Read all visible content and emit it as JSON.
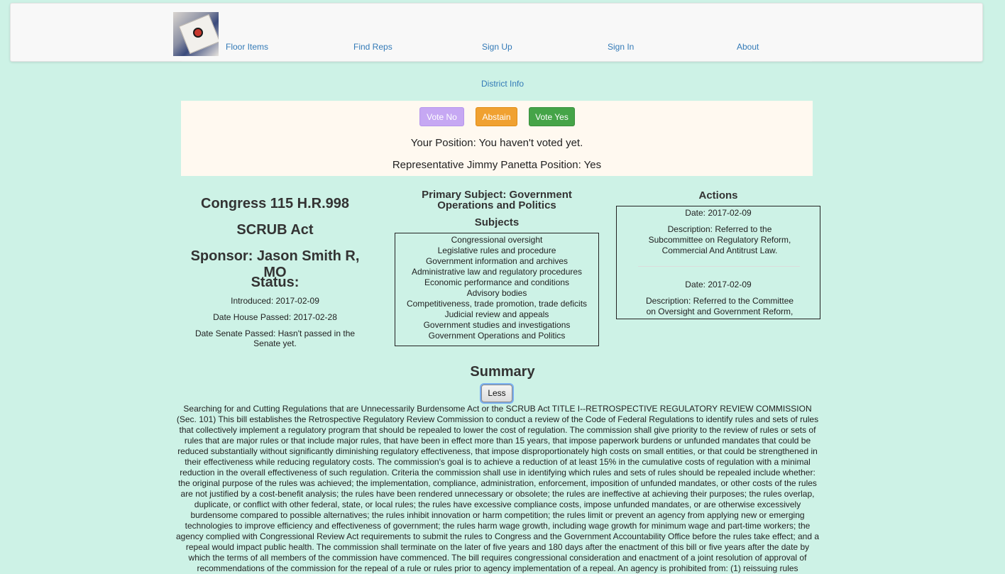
{
  "nav": {
    "items": [
      "Floor Items",
      "Find Reps",
      "Sign Up",
      "Sign In",
      "About"
    ],
    "district_link": "District Info"
  },
  "vote": {
    "buttons": {
      "no": "Vote No",
      "abstain": "Abstain",
      "yes": "Vote Yes"
    },
    "your_position": "Your Position: You haven't voted yet.",
    "rep_position": "Representative Jimmy Panetta Position: Yes",
    "colors": {
      "no": "#c6a8f3",
      "abstain": "#f0a131",
      "yes": "#45a448"
    }
  },
  "bill": {
    "congress": "Congress 115 H.R.998",
    "name": "SCRUB Act",
    "sponsor": "Sponsor: Jason Smith R, MO",
    "status_heading": "Status:",
    "introduced": "Introduced: 2017-02-09",
    "house_passed": "Date House Passed: 2017-02-28",
    "senate_passed": "Date Senate Passed: Hasn't passed in the Senate yet."
  },
  "subjects": {
    "primary": "Primary Subject: Government Operations and Politics",
    "heading": "Subjects",
    "items": [
      "Congressional oversight",
      "Legislative rules and procedure",
      "Government information and archives",
      "Administrative law and regulatory procedures",
      "Economic performance and conditions",
      "Advisory bodies",
      "Competitiveness, trade promotion, trade deficits",
      "Judicial review and appeals",
      "Government studies and investigations",
      "Government Operations and Politics"
    ]
  },
  "actions": {
    "heading": "Actions",
    "items": [
      {
        "date": "Date: 2017-02-09",
        "description": "Description: Referred to the Subcommittee on Regulatory Reform, Commercial And Antitrust Law."
      },
      {
        "date": "Date: 2017-02-09",
        "description": "Description: Referred to the Committee on Oversight and Government Reform, and in addition to the Committee on the Judiciary."
      }
    ]
  },
  "summary": {
    "heading": "Summary",
    "toggle_label": "Less",
    "text": "Searching for and Cutting Regulations that are Unnecessarily Burdensome Act or the SCRUB Act TITLE I--RETROSPECTIVE REGULATORY REVIEW COMMISSION (Sec. 101) This bill establishes the Retrospective Regulatory Review Commission to conduct a review of the Code of Federal Regulations to identify rules and sets of rules that collectively implement a regulatory program that should be repealed to lower the cost of regulation. The commission shall give priority to the review of rules or sets of rules that are major rules or that include major rules, that have been in effect more than 15 years, that impose paperwork burdens or unfunded mandates that could be reduced substantially without significantly diminishing regulatory effectiveness, that impose disproportionately high costs on small entities, or that could be strengthened in their effectiveness while reducing regulatory costs. The commission's goal is to achieve a reduction of at least 15% in the cumulative costs of regulation with a minimal reduction in the overall effectiveness of such regulation. Criteria the commission shall use in identifying which rules and sets of rules should be repealed include whether: the original purpose of the rules was achieved; the implementation, compliance, administration, enforcement, imposition of unfunded mandates, or other costs of the rules are not justified by a cost-benefit analysis; the rules have been rendered unnecessary or obsolete; the rules are ineffective at achieving their purposes; the rules overlap, duplicate, or conflict with other federal, state, or local rules; the rules have excessive compliance costs, impose unfunded mandates, or are otherwise excessively burdensome compared to possible alternatives; the rules inhibit innovation or harm competition; the rules limit or prevent an agency from applying new or emerging technologies to improve efficiency and effectiveness of government; the rules harm wage growth, including wage growth for minimum wage and part-time workers; the agency complied with Congressional Review Act requirements to submit the rules to Congress and the Government Accountability Office before the rules take effect; and a repeal would impact public health. The commission shall terminate on the later of five years and 180 days after the enactment of this bill or five years after the date by which the terms of all members of the commission have commenced. The bill requires congressional consideration and enactment of a joint resolution of approval of recommendations of the commission for the repeal of a rule or rules prior to agency implementation of a repeal. An agency is prohibited from: (1) reissuing rules"
  }
}
